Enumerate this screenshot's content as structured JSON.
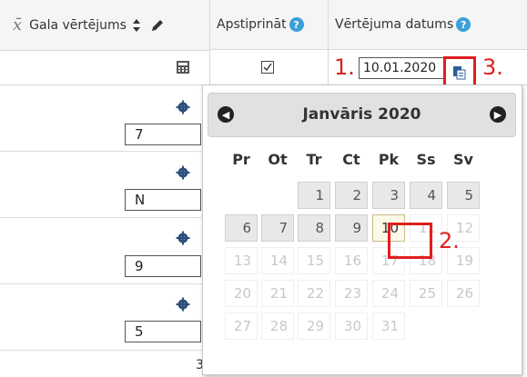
{
  "header": {
    "col1_label": "Gala vērtējums",
    "col2_label": "Apstiprināt",
    "col3_label": "Vērtējuma datums"
  },
  "first_row": {
    "checkbox_checked": true,
    "date_value": "10.01.2020"
  },
  "grade_rows": [
    {
      "value": "7"
    },
    {
      "value": "N"
    },
    {
      "value": "9"
    },
    {
      "value": "5"
    }
  ],
  "partial_text": "3",
  "annotations": {
    "step1": "1.",
    "step2": "2.",
    "step3": "3."
  },
  "datepicker": {
    "title": "Janvāris 2020",
    "weekdays": [
      "Pr",
      "Ot",
      "Tr",
      "Ct",
      "Pk",
      "Ss",
      "Sv"
    ],
    "weeks": [
      [
        "",
        "",
        "1",
        "2",
        "3",
        "4",
        "5"
      ],
      [
        "6",
        "7",
        "8",
        "9",
        "10",
        "11",
        "12"
      ],
      [
        "13",
        "14",
        "15",
        "16",
        "17",
        "18",
        "19"
      ],
      [
        "20",
        "21",
        "22",
        "23",
        "24",
        "25",
        "26"
      ],
      [
        "27",
        "28",
        "29",
        "30",
        "31",
        "",
        ""
      ]
    ],
    "selected_day": "10",
    "enabled_through": "10"
  },
  "colors": {
    "accent_help": "#3aa0d8",
    "annotation_red": "#e02020",
    "calendar_icon": "#2b5f9e"
  },
  "icons": [
    "xbar-sum-icon",
    "sort-icon",
    "pencil-icon",
    "help-icon",
    "calculator-icon",
    "checkbox-icon",
    "copy-icon",
    "gear-icon",
    "prev-arrow-icon",
    "next-arrow-icon"
  ]
}
